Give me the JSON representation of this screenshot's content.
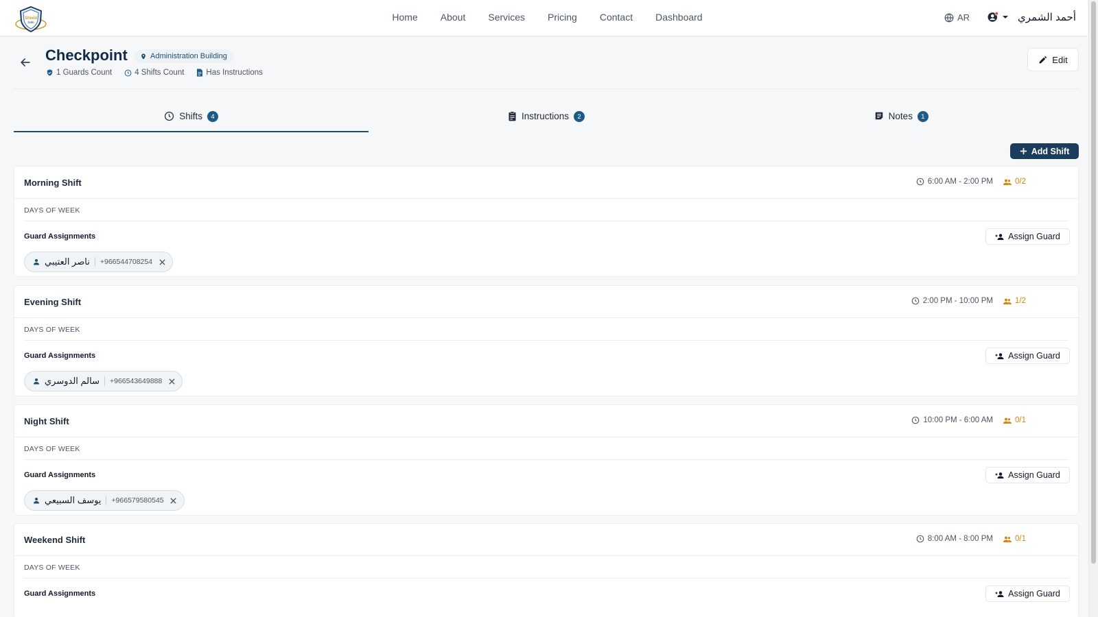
{
  "brand": {
    "logo_text": "Shield Safe"
  },
  "nav": {
    "items": [
      {
        "label": "Home"
      },
      {
        "label": "About"
      },
      {
        "label": "Services"
      },
      {
        "label": "Pricing"
      },
      {
        "label": "Contact"
      },
      {
        "label": "Dashboard"
      }
    ]
  },
  "lang": {
    "label": "AR"
  },
  "user": {
    "name": "أحمد الشمري"
  },
  "page": {
    "title": "Checkpoint",
    "location": "Administration Building",
    "meta": {
      "guards": "1 Guards Count",
      "shifts": "4 Shifts Count",
      "instructions": "Has Instructions"
    },
    "edit_label": "Edit"
  },
  "tabs": [
    {
      "label": "Shifts",
      "count": "4"
    },
    {
      "label": "Instructions",
      "count": "2"
    },
    {
      "label": "Notes",
      "count": "1"
    }
  ],
  "add_shift_label": "Add Shift",
  "shifts": [
    {
      "name": "Morning Shift",
      "time": "6:00 AM - 2:00 PM",
      "capacity": "0/2",
      "days_label": "DAYS OF WEEK",
      "ga_label": "Guard Assignments",
      "assign_label": "Assign Guard",
      "guard": {
        "name": "ناصر العتيبي",
        "phone": "+966544708254"
      }
    },
    {
      "name": "Evening Shift",
      "time": "2:00 PM - 10:00 PM",
      "capacity": "1/2",
      "days_label": "DAYS OF WEEK",
      "ga_label": "Guard Assignments",
      "assign_label": "Assign Guard",
      "guard": {
        "name": "سالم الدوسري",
        "phone": "+966543649888"
      }
    },
    {
      "name": "Night Shift",
      "time": "10:00 PM - 6:00 AM",
      "capacity": "0/1",
      "days_label": "DAYS OF WEEK",
      "ga_label": "Guard Assignments",
      "assign_label": "Assign Guard",
      "guard": {
        "name": "يوسف السبيعي",
        "phone": "+966579580545"
      }
    },
    {
      "name": "Weekend Shift",
      "time": "8:00 AM - 8:00 PM",
      "capacity": "0/1",
      "days_label": "DAYS OF WEEK",
      "ga_label": "Guard Assignments",
      "assign_label": "Assign Guard"
    }
  ],
  "colors": {
    "primary": "#1c3c5e",
    "accent": "#1e5a86",
    "capacity": "#d4870f"
  }
}
